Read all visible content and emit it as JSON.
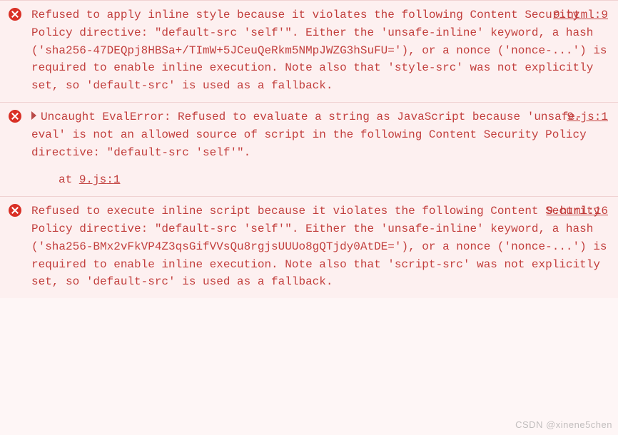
{
  "entries": [
    {
      "expandable": false,
      "message": "Refused to apply inline style because it violates the following Content Security Policy directive: \"default-src 'self'\". Either the 'unsafe-inline' keyword, a hash ('sha256-47DEQpj8HBSa+/TImW+5JCeuQeRkm5NMpJWZG3hSuFU='), or a nonce ('nonce-...') is required to enable inline execution. Note also that 'style-src' was not explicitly set, so 'default-src' is used as a fallback.",
      "source_file": "9.html",
      "source_line": "9",
      "stack": null
    },
    {
      "expandable": true,
      "message": "Uncaught EvalError: Refused to evaluate a string as JavaScript because 'unsafe-eval' is not an allowed source of script in the following Content Security Policy directive: \"default-src 'self'\".",
      "source_file": "9.js",
      "source_line": "1",
      "stack": {
        "prefix": "at ",
        "file": "9.js",
        "line": "1"
      }
    },
    {
      "expandable": false,
      "message": "Refused to execute inline script because it violates the following Content Security Policy directive: \"default-src 'self'\". Either the 'unsafe-inline' keyword, a hash ('sha256-BMx2vFkVP4Z3qsGifVVsQu8rgjsUUUo8gQTjdy0AtDE='), or a nonce ('nonce-...') is required to enable inline execution. Note also that 'script-src' was not explicitly set, so 'default-src' is used as a fallback.",
      "source_file": "9.html",
      "source_line": "16",
      "stack": null
    }
  ],
  "watermark": "CSDN @xinene5chen"
}
